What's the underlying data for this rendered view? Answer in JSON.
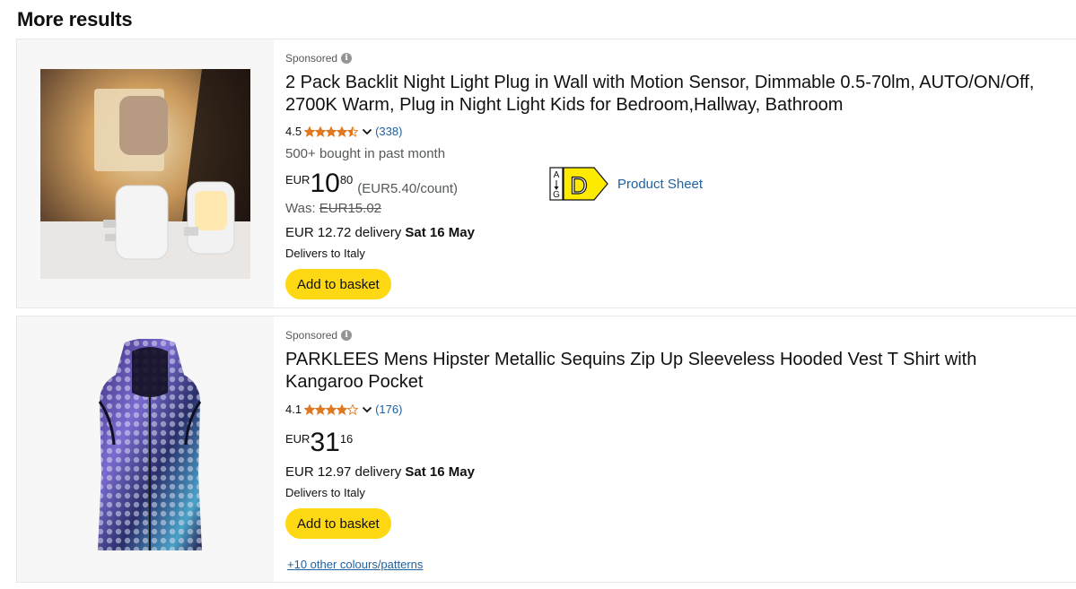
{
  "section_title": "More results",
  "products": [
    {
      "sponsored": "Sponsored",
      "title": "2 Pack Backlit Night Light Plug in Wall with Motion Sensor, Dimmable 0.5-70lm, AUTO/ON/Off, 2700K Warm, Plug in Night Light Kids for Bedroom,Hallway, Bathroom",
      "rating": "4.5",
      "rating_value": 4.5,
      "review_count": "(338)",
      "bought": "500+ bought in past month",
      "price_currency": "EUR",
      "price_whole": "10",
      "price_fraction": "80",
      "unit_price": "(EUR5.40/count)",
      "was_label": "Was:",
      "was_price": "EUR15.02",
      "delivery_prefix": "EUR 12.72 delivery",
      "delivery_date": "Sat 16 May",
      "delivers_to": "Delivers to Italy",
      "basket_label": "Add to basket",
      "energy_class": "D",
      "energy_scale_top": "A",
      "energy_scale_bottom": "G",
      "product_sheet": "Product Sheet",
      "energy_color": "#FFEB00"
    },
    {
      "sponsored": "Sponsored",
      "title": "PARKLEES Mens Hipster Metallic Sequins Zip Up Sleeveless Hooded Vest T Shirt with Kangaroo Pocket",
      "rating": "4.1",
      "rating_value": 4.1,
      "review_count": "(176)",
      "price_currency": "EUR",
      "price_whole": "31",
      "price_fraction": "16",
      "delivery_prefix": "EUR 12.97 delivery",
      "delivery_date": "Sat 16 May",
      "delivers_to": "Delivers to Italy",
      "basket_label": "Add to basket",
      "colours_link": "+10 other colours/patterns"
    }
  ],
  "colors": {
    "star": "#DE7921",
    "link": "#2162A1",
    "button": "#FFD814"
  },
  "icons": [
    "info-icon",
    "star-icon",
    "chevron-down-icon",
    "energy-label-icon"
  ]
}
